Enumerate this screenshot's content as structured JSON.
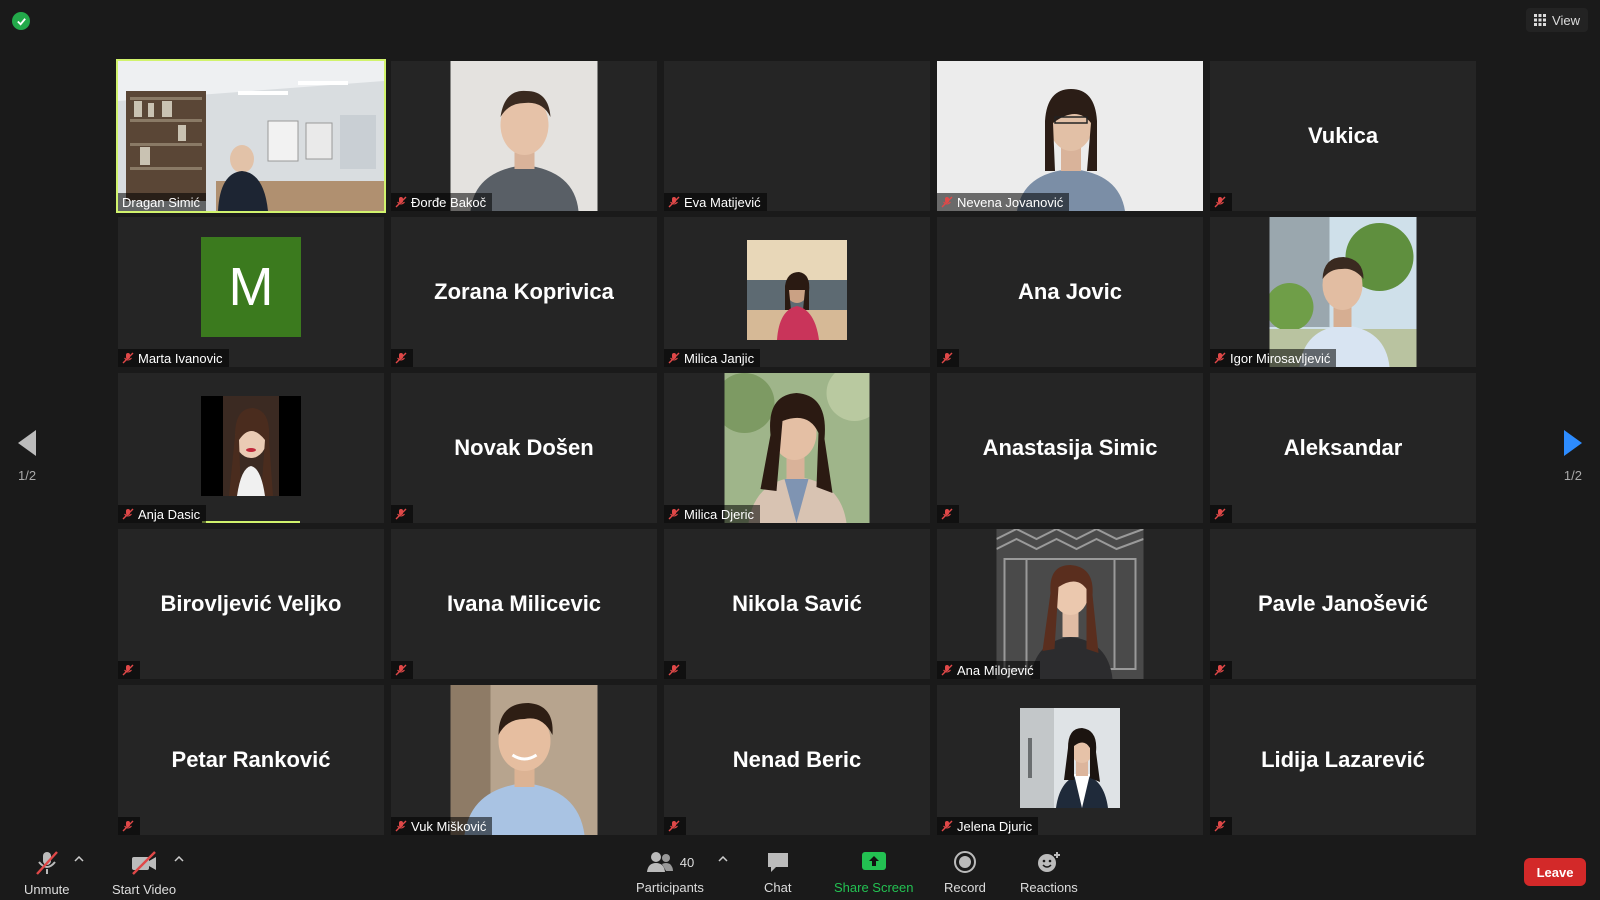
{
  "view_label": "View",
  "page_indicator_left": "1/2",
  "page_indicator_right": "1/2",
  "tiles": [
    {
      "name": "Dragan Simić",
      "type": "video-classroom",
      "muted": false,
      "active": true
    },
    {
      "name": "Đorđe Bakoč",
      "type": "video-portrait",
      "muted": true
    },
    {
      "name": "Eva Matijević",
      "type": "blank",
      "muted": true
    },
    {
      "name": "Nevena Jovanović",
      "type": "video-wide",
      "muted": true
    },
    {
      "name": "Vukica",
      "display_name": "Vukica",
      "type": "name-only",
      "muted": true
    },
    {
      "name": "Marta Ivanovic",
      "avatar_letter": "M",
      "type": "avatar-letter",
      "muted": true
    },
    {
      "name": "Zorana Koprivica",
      "display_name": "Zorana Koprivica",
      "type": "name-only",
      "muted": true
    },
    {
      "name": "Milica Janjic",
      "type": "thumb",
      "muted": true
    },
    {
      "name": "Ana Jovic",
      "display_name": "Ana Jovic",
      "type": "name-only",
      "muted": true
    },
    {
      "name": "Igor Mirosavljević",
      "type": "video-portrait",
      "muted": true
    },
    {
      "name": "Anja Dasic",
      "type": "thumb",
      "muted": true,
      "talking": true
    },
    {
      "name": "Novak Došen",
      "display_name": "Novak Došen",
      "type": "name-only",
      "muted": true
    },
    {
      "name": "Milica Djeric",
      "type": "video-portrait",
      "muted": true
    },
    {
      "name": "Anastasija Simic",
      "display_name": "Anastasija Simic",
      "type": "name-only",
      "muted": true
    },
    {
      "name": "Aleksandar",
      "display_name": "Aleksandar",
      "type": "name-only",
      "muted": true
    },
    {
      "name": "Birovljević Veljko",
      "display_name": "Birovljević Veljko",
      "type": "name-only",
      "muted": true
    },
    {
      "name": "Ivana Milicevic",
      "display_name": "Ivana Milicevic",
      "type": "name-only",
      "muted": true
    },
    {
      "name": "Nikola Savić",
      "display_name": "Nikola Savić",
      "type": "name-only",
      "muted": true
    },
    {
      "name": "Ana Milojević",
      "type": "video-portrait",
      "muted": true
    },
    {
      "name": "Pavle Janošević",
      "display_name": "Pavle Janošević",
      "type": "name-only",
      "muted": true
    },
    {
      "name": "Petar Ranković",
      "display_name": "Petar Ranković",
      "type": "name-only",
      "muted": true
    },
    {
      "name": "Vuk Mišković",
      "type": "video-portrait",
      "muted": true
    },
    {
      "name": "Nenad Beric",
      "display_name": "Nenad Beric",
      "type": "name-only",
      "muted": true
    },
    {
      "name": "Jelena Djuric",
      "type": "thumb",
      "muted": true
    },
    {
      "name": "Lidija Lazarević",
      "display_name": "Lidija Lazarević",
      "type": "name-only",
      "muted": true
    }
  ],
  "toolbar": {
    "unmute_label": "Unmute",
    "start_video_label": "Start Video",
    "participants_label": "Participants",
    "participants_count": "40",
    "chat_label": "Chat",
    "share_screen_label": "Share Screen",
    "record_label": "Record",
    "reactions_label": "Reactions",
    "leave_label": "Leave"
  },
  "colors": {
    "active_speaker_border": "#d1f36d",
    "share_screen_green": "#23c152",
    "leave_red": "#d32929",
    "mute_red": "#e04848",
    "avatar_green": "#3b7a1e"
  }
}
